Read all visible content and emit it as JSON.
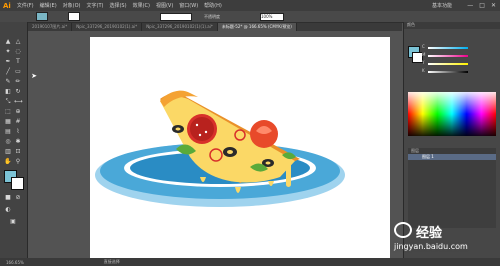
{
  "app": {
    "logo": "Ai",
    "menu": [
      "文件(F)",
      "编辑(E)",
      "对象(O)",
      "文字(T)",
      "选择(S)",
      "效果(C)",
      "视图(V)",
      "窗口(W)",
      "帮助(H)"
    ],
    "workspace": "基本功能",
    "window_controls": [
      "—",
      "□",
      "✕"
    ]
  },
  "control_bar": {
    "opacity_label": "不透明度",
    "opacity_value": "100%"
  },
  "tabs": [
    {
      "label": "20190107图片.ai*",
      "active": false
    },
    {
      "label": "Npic_337296_20190102(1).ai*",
      "active": false
    },
    {
      "label": "Npic_337296_20190102(1)(1).ai*",
      "active": false
    },
    {
      "label": "未标题-52* @ 166.65% (CMYK/预览)",
      "active": true
    }
  ],
  "panel": {
    "title": "颜色",
    "sliders": [
      {
        "label": "C",
        "value": "",
        "color": "#3ab0e0"
      },
      {
        "label": "M",
        "value": "",
        "color": "#e040a0"
      },
      {
        "label": "Y",
        "value": "",
        "color": "#e0d040"
      },
      {
        "label": "K",
        "value": "",
        "color": "#888888"
      }
    ],
    "layers_title": "图层",
    "layer_name": "图层 1"
  },
  "status": {
    "zoom": "166.65%",
    "tool": "直接选择"
  },
  "watermark": {
    "text": "经验",
    "url": "jingyan.baidu.com"
  },
  "colors": {
    "plate_outer": "#4aa8d8",
    "plate_inner": "#2a8cc4",
    "crust": "#f4a233",
    "cheese": "#fbd866",
    "pepperoni": "#d8302a",
    "tomato": "#e84a2a",
    "olive": "#2a2a2a",
    "basil": "#5aaa3a",
    "fill_swatch": "#7bc3d6"
  }
}
